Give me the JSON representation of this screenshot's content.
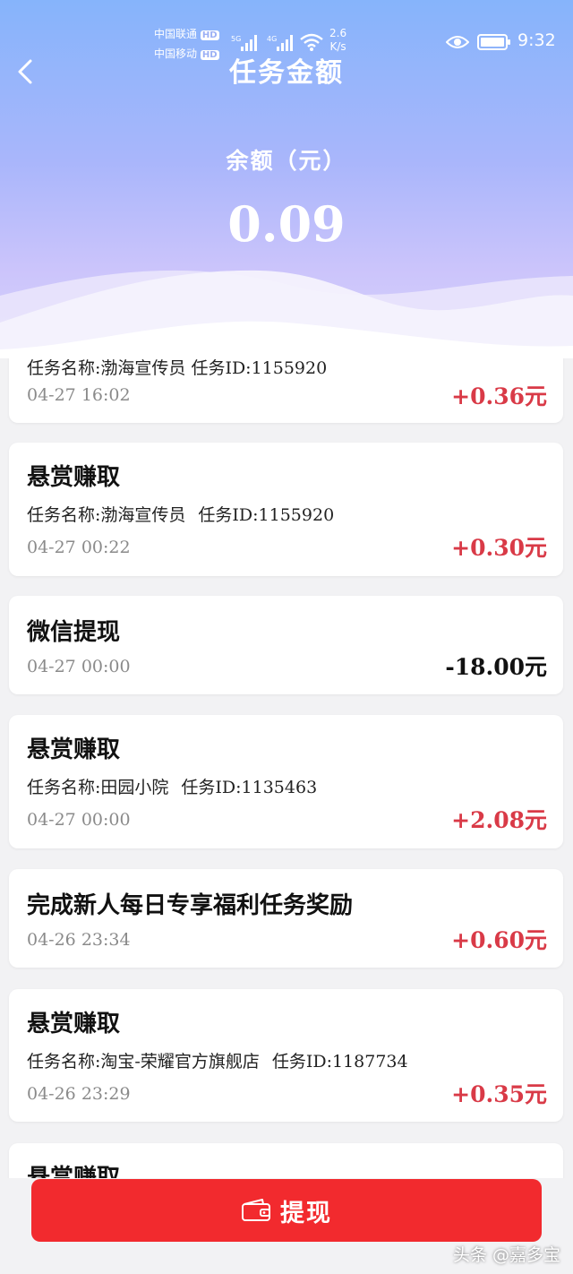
{
  "status_bar": {
    "carrier_1": "中国联通",
    "carrier_2": "中国移动",
    "hd_badge": "HD",
    "net_5g": "5G",
    "net_4g": "4G",
    "speed_value": "2.6",
    "speed_unit": "K/s",
    "time": "9:32"
  },
  "header": {
    "title": "任务金额",
    "balance_label": "余额（元）",
    "balance_value": "0.09"
  },
  "records": [
    {
      "title": "任务名称:渤海宣传员  任务ID:1155920",
      "time": "04-27 16:02",
      "amount": "+0.36元"
    },
    {
      "title": "悬赏赚取",
      "task_label": "任务名称:渤海宣传员",
      "task_id": "任务ID:1155920",
      "time": "04-27 00:22",
      "amount": "+0.30元"
    },
    {
      "title": "微信提现",
      "time": "04-27 00:00",
      "amount": "-18.00元"
    },
    {
      "title": "悬赏赚取",
      "task_label": "任务名称:田园小院",
      "task_id": "任务ID:1135463",
      "time": "04-27 00:00",
      "amount": "+2.08元"
    },
    {
      "title": "完成新人每日专享福利任务奖励",
      "time": "04-26 23:34",
      "amount": "+0.60元"
    },
    {
      "title": "悬赏赚取",
      "task_label": "任务名称:淘宝-荣耀官方旗舰店",
      "task_id": "任务ID:1187734",
      "time": "04-26 23:29",
      "amount": "+0.35元"
    },
    {
      "title": "悬赏赚取"
    }
  ],
  "withdraw_button": {
    "label": "提现"
  },
  "watermark": "头条 @嘉多宝",
  "colors": {
    "positive": "#d93a47",
    "negative": "#111111",
    "button": "#f22a2e"
  }
}
